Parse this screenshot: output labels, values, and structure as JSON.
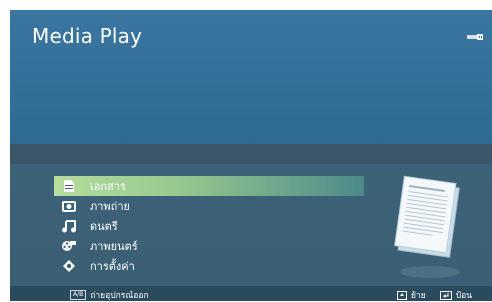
{
  "app": {
    "title": "Media Play"
  },
  "icons": {
    "usb": "usb-icon"
  },
  "menu": {
    "selected_index": 0,
    "items": [
      {
        "label": "เอกสาร",
        "icon": "document-icon"
      },
      {
        "label": "ภาพถ่าย",
        "icon": "photo-icon"
      },
      {
        "label": "ดนตรี",
        "icon": "music-icon"
      },
      {
        "label": "ภาพยนตร์",
        "icon": "movie-icon"
      },
      {
        "label": "การตั้งค่า",
        "icon": "settings-icon"
      }
    ]
  },
  "footer": {
    "remove_device": "ถ่ายอุปกรณ์ออก",
    "move": "ย้าย",
    "enter": "ป้อน",
    "key_remove": "A/B"
  },
  "colors": {
    "background": "#2f6283",
    "highlight": "#b6dc9e",
    "footer": "#2a4b5e"
  }
}
